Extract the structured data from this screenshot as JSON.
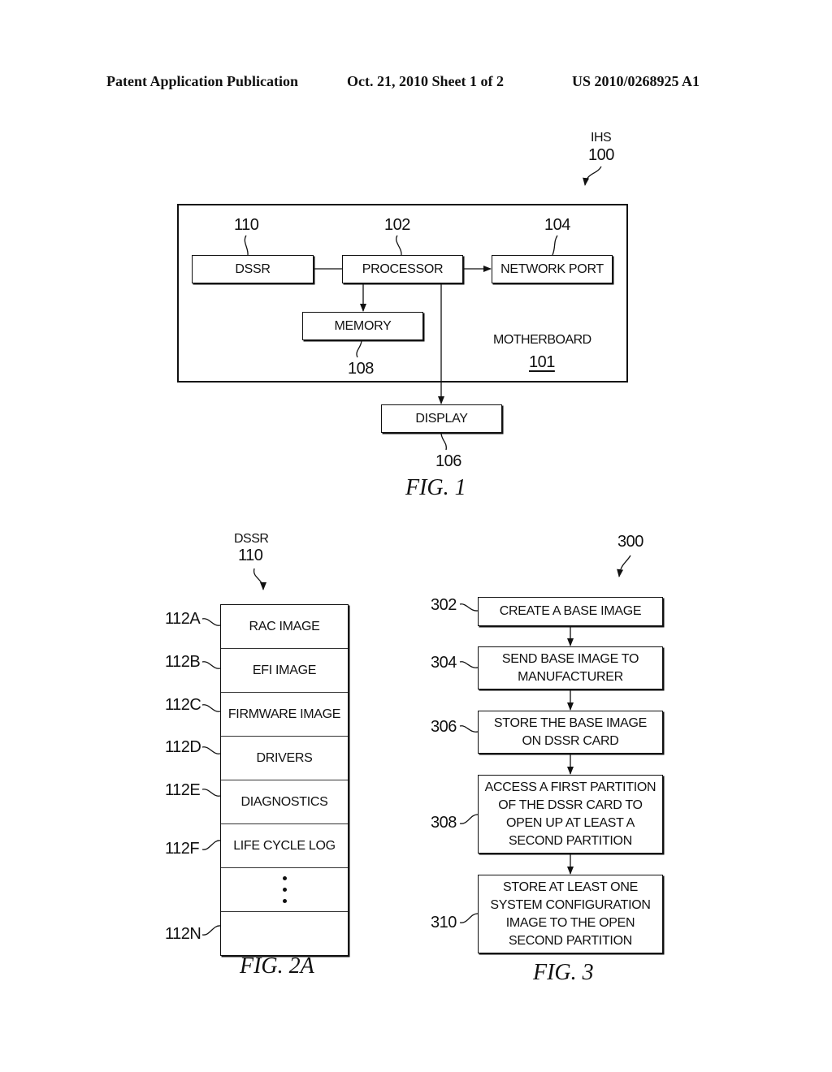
{
  "header": {
    "publication": "Patent Application Publication",
    "date_sheet": "Oct. 21, 2010   Sheet 1 of 2",
    "number": "US 2010/0268925 A1"
  },
  "fig1": {
    "caption": "FIG. 1",
    "system_label": "IHS",
    "system_ref": "100",
    "motherboard_label": "MOTHERBOARD",
    "motherboard_ref": "101",
    "blocks": {
      "dssr": {
        "label": "DSSR",
        "ref": "110"
      },
      "processor": {
        "label": "PROCESSOR",
        "ref": "102"
      },
      "network_port": {
        "label": "NETWORK PORT",
        "ref": "104"
      },
      "memory": {
        "label": "MEMORY",
        "ref": "108"
      },
      "display": {
        "label": "DISPLAY",
        "ref": "106"
      }
    }
  },
  "fig2a": {
    "caption": "FIG. 2A",
    "title": "DSSR",
    "ref": "110",
    "partitions": [
      {
        "ref": "112A",
        "label": "RAC IMAGE"
      },
      {
        "ref": "112B",
        "label": "EFI IMAGE"
      },
      {
        "ref": "112C",
        "label": "FIRMWARE IMAGE"
      },
      {
        "ref": "112D",
        "label": "DRIVERS"
      },
      {
        "ref": "112E",
        "label": "DIAGNOSTICS"
      },
      {
        "ref": "112F",
        "label": "LIFE CYCLE LOG"
      },
      {
        "ref": "",
        "label": "..."
      },
      {
        "ref": "112N",
        "label": ""
      }
    ]
  },
  "fig3": {
    "caption": "FIG. 3",
    "ref": "300",
    "steps": [
      {
        "ref": "302",
        "lines": [
          "CREATE A BASE IMAGE"
        ]
      },
      {
        "ref": "304",
        "lines": [
          "SEND BASE IMAGE TO",
          "MANUFACTURER"
        ]
      },
      {
        "ref": "306",
        "lines": [
          "STORE THE BASE IMAGE",
          "ON DSSR CARD"
        ]
      },
      {
        "ref": "308",
        "lines": [
          "ACCESS A FIRST PARTITION",
          "OF THE DSSR CARD TO",
          "OPEN UP AT LEAST A",
          "SECOND PARTITION"
        ]
      },
      {
        "ref": "310",
        "lines": [
          "STORE AT LEAST ONE",
          "SYSTEM CONFIGURATION",
          "IMAGE TO THE OPEN",
          "SECOND PARTITION"
        ]
      }
    ]
  }
}
